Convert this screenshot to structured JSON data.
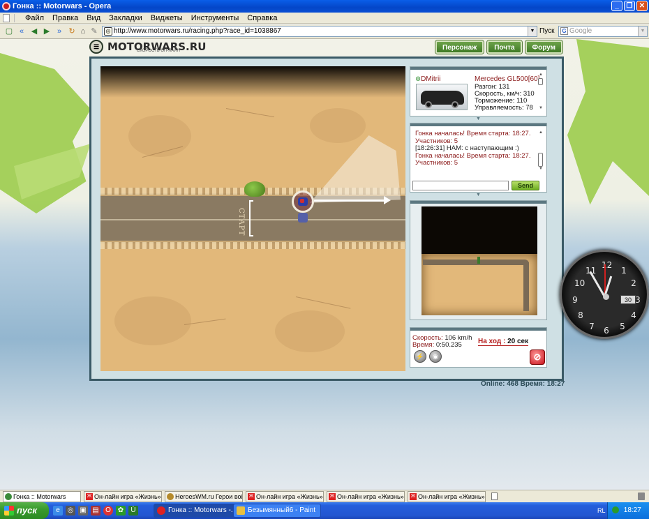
{
  "window": {
    "title": "Гонка :: Motorwars - Opera",
    "buttons": [
      "_",
      "❐",
      "✕"
    ]
  },
  "menu": [
    "Файл",
    "Правка",
    "Вид",
    "Закладки",
    "Виджеты",
    "Инструменты",
    "Справка"
  ],
  "address": {
    "url": "http://www.motorwars.ru/racing.php?race_id=1038867",
    "search_label": "Пуск",
    "search_placeholder": "Google"
  },
  "site": {
    "logo": "MOTORWARS.RU",
    "logo_sub": "СКОРОСТЬ ОН-ЛАЙН",
    "nav": [
      "Персонаж",
      "Почта",
      "Форум"
    ]
  },
  "track": {
    "start_label": "СТАРТ"
  },
  "car": {
    "driver": "DMitrii",
    "model": "Mercedes GL500[60]",
    "stats": [
      "Разгон: 131",
      "Скорость, км/ч: 310",
      "Торможение: 110",
      "Управляемость: 78"
    ]
  },
  "chat": {
    "lines": [
      {
        "type": "sys",
        "text": "Гонка началась! Время старта: 18:27."
      },
      {
        "type": "sys",
        "text": "Участников: 5"
      },
      {
        "type": "usr",
        "text": "[18:26:31] НАМ: с наступающим :)"
      },
      {
        "type": "sys",
        "text": "Гонка началась! Время старта: 18:27."
      },
      {
        "type": "sys",
        "text": "Участников: 5"
      }
    ],
    "send_label": "Send"
  },
  "status": {
    "speed_label": "Скорость:",
    "speed_value": "106 km/h",
    "time_label": "Время:",
    "time_value": "0:50.235",
    "turn_label": "На ход :",
    "turn_value": "20 сек"
  },
  "footer": {
    "online": "Online: 468  Время: 18:27"
  },
  "clock": {
    "numbers": [
      "12",
      "1",
      "2",
      "3",
      "4",
      "5",
      "6",
      "7",
      "8",
      "9",
      "10",
      "11"
    ],
    "date": "30"
  },
  "tabs": [
    {
      "label": "Гонка :: Motorwars",
      "icon": "motorwars-icon",
      "active": true
    },
    {
      "label": "Он-лайн игра «Жизнь» ...",
      "icon": "zh-icon"
    },
    {
      "label": "HeroesWM.ru Герои вой...",
      "icon": "heroes-icon"
    },
    {
      "label": "Он-лайн игра «Жизнь» ...",
      "icon": "zh-icon"
    },
    {
      "label": "Он-лайн игра «Жизнь» ...",
      "icon": "zh-icon"
    },
    {
      "label": "Он-лайн игра «Жизнь» ...",
      "icon": "zh-icon"
    }
  ],
  "taskbar": {
    "start": "пуск",
    "windows": [
      {
        "label": "Гонка :: Motorwars -...",
        "active": true
      },
      {
        "label": "Безымянный6 - Paint"
      }
    ],
    "lang": "RL",
    "time": "18:27"
  }
}
